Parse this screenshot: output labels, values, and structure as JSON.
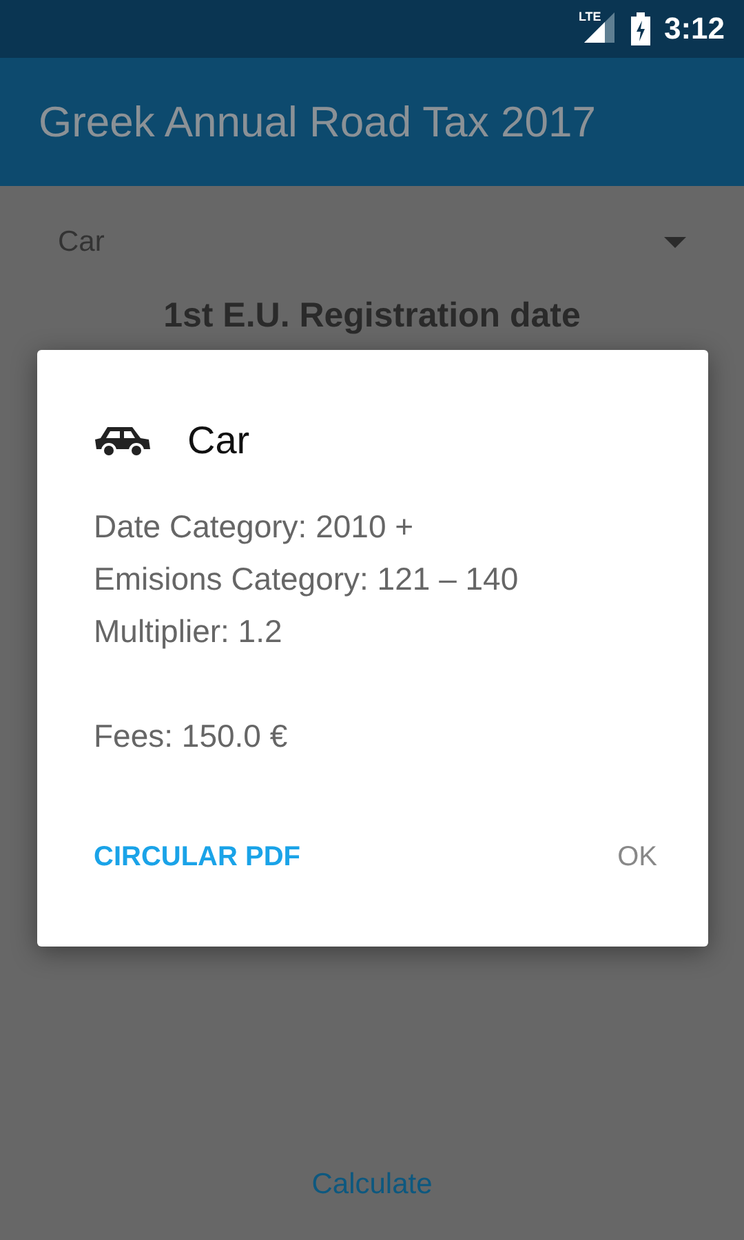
{
  "status_bar": {
    "network": "LTE",
    "time": "3:12"
  },
  "app_bar": {
    "title": "Greek Annual Road Tax 2017"
  },
  "form": {
    "vehicle_type": "Car",
    "section_heading": "1st E.U. Registration date",
    "calculate_button": "Calculate"
  },
  "dialog": {
    "title": "Car",
    "lines": [
      "Date Category: 2010 +",
      "Emisions Category: 121 – 140",
      "Multiplier: 1.2"
    ],
    "fees": "Fees: 150.0 €",
    "buttons": [
      {
        "label": "CIRCULAR PDF",
        "kind": "accent"
      },
      {
        "label": "OK",
        "kind": "plain"
      }
    ]
  }
}
